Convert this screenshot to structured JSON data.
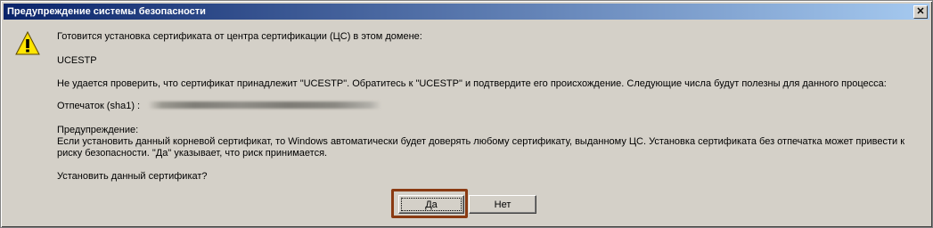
{
  "window": {
    "title": "Предупреждение системы безопасности",
    "close_glyph": "✕"
  },
  "icons": {
    "warning": "warning-icon",
    "close": "close-icon"
  },
  "message": {
    "line1": "Готовится установка сертификата от центра сертификации (ЦС) в этом домене:",
    "line2": "UCESTP",
    "line3": "Не удается проверить, что сертификат принадлежит \"UCESTP\". Обратитесь к \"UCESTP\" и подтвердите его происхождение. Следующие числа будут полезны для данного процесса:",
    "thumbprint_label": "Отпечаток (sha1) :",
    "warning_heading": "Предупреждение:",
    "warning_line1": "Если установить данный корневой сертификат, то Windows автоматически будет доверять любому сертификату, выданному ЦС. Установка сертификата без отпечатка может привести к",
    "warning_line2": "риску безопасности. \"Да\" указывает, что риск принимается.",
    "question": "Установить данный сертификат?"
  },
  "buttons": {
    "yes": "Да",
    "no": "Нет"
  },
  "colors": {
    "titlebar_start": "#0a246a",
    "titlebar_end": "#a6caf0",
    "face": "#d4d0c8",
    "highlight_border": "#8a3a12"
  }
}
